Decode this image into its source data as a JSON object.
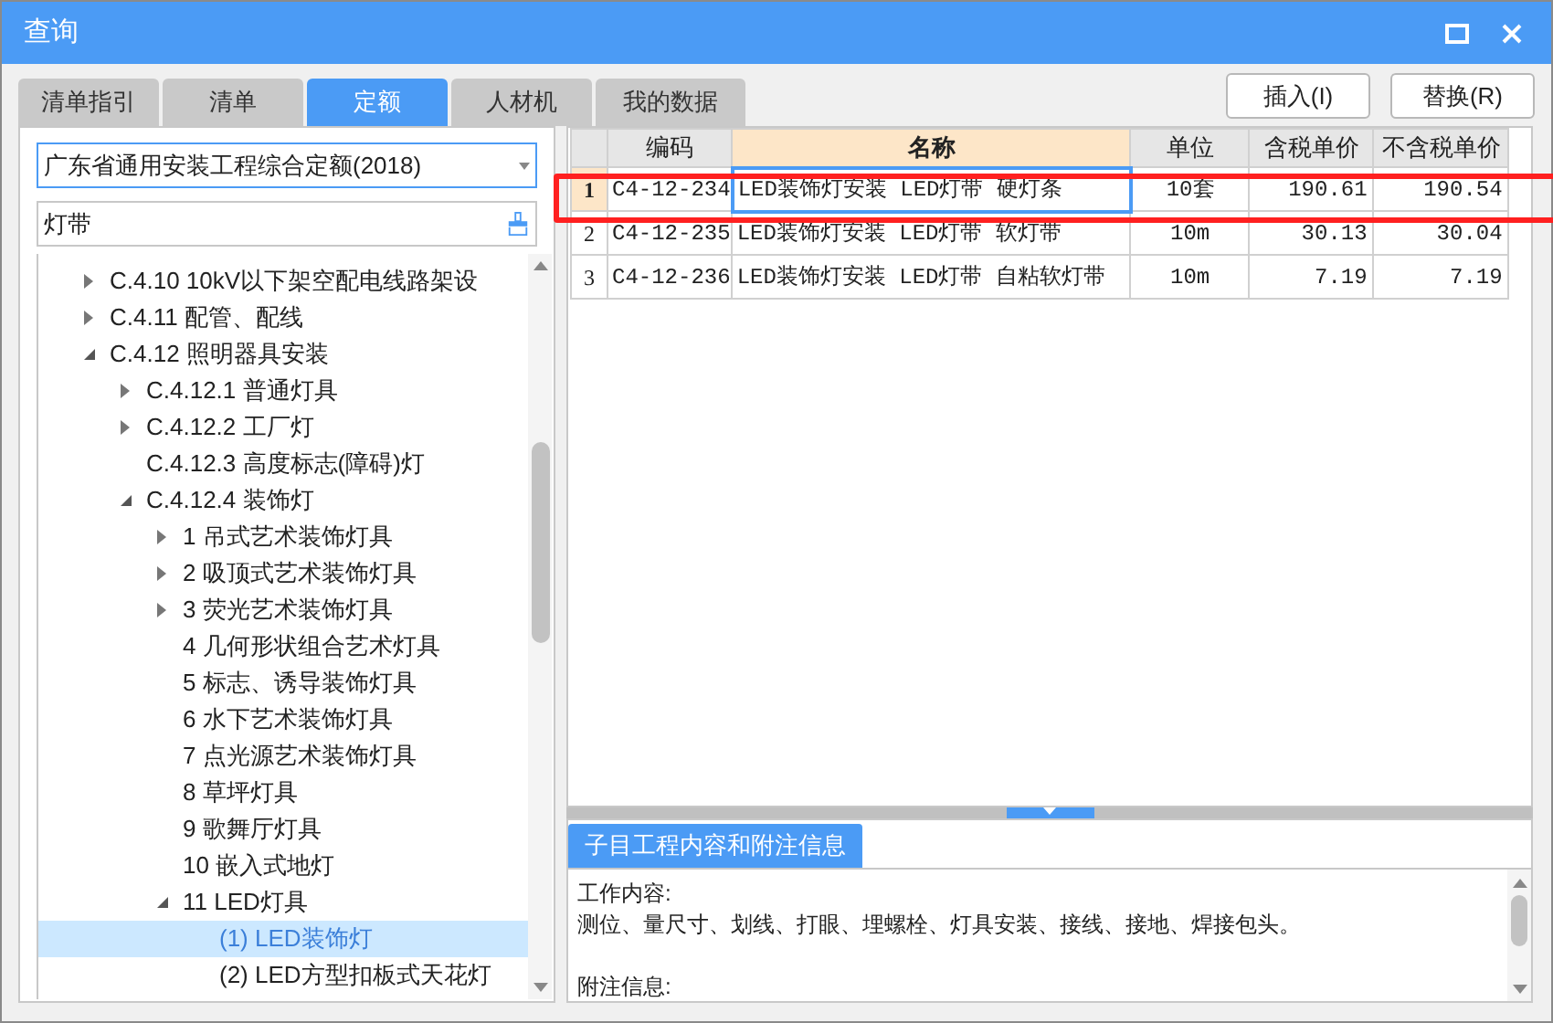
{
  "window": {
    "title": "查询"
  },
  "tabs": [
    {
      "label": "清单指引",
      "selected": false
    },
    {
      "label": "清单",
      "selected": false
    },
    {
      "label": "定额",
      "selected": true
    },
    {
      "label": "人材机",
      "selected": false
    },
    {
      "label": "我的数据",
      "selected": false
    }
  ],
  "buttons": [
    "插入(I)",
    "替换(R)"
  ],
  "library_select": {
    "value": "广东省通用安装工程综合定额(2018)"
  },
  "search": {
    "value": "灯带"
  },
  "tree": [
    {
      "label": "C.4.10 10kV以下架空配电线路架设",
      "expanded": false,
      "selected": false
    },
    {
      "label": "C.4.11 配管、配线",
      "expanded": false,
      "selected": false
    },
    {
      "label": "C.4.12 照明器具安装",
      "expanded": true,
      "selected": false,
      "children": [
        {
          "label": "C.4.12.1 普通灯具",
          "expanded": false,
          "selected": false
        },
        {
          "label": "C.4.12.2 工厂灯",
          "expanded": false,
          "selected": false
        },
        {
          "label": "C.4.12.3 高度标志(障碍)灯",
          "selected": false
        },
        {
          "label": "C.4.12.4 装饰灯",
          "expanded": true,
          "selected": false,
          "children": [
            {
              "label": "1 吊式艺术装饰灯具",
              "expanded": false,
              "selected": false
            },
            {
              "label": "2 吸顶式艺术装饰灯具",
              "expanded": false,
              "selected": false
            },
            {
              "label": "3 荧光艺术装饰灯具",
              "expanded": false,
              "selected": false
            },
            {
              "label": "4 几何形状组合艺术灯具",
              "selected": false
            },
            {
              "label": "5 标志、诱导装饰灯具",
              "selected": false
            },
            {
              "label": "6 水下艺术装饰灯具",
              "selected": false
            },
            {
              "label": "7 点光源艺术装饰灯具",
              "selected": false
            },
            {
              "label": "8 草坪灯具",
              "selected": false
            },
            {
              "label": "9 歌舞厅灯具",
              "selected": false
            },
            {
              "label": "10 嵌入式地灯",
              "selected": false
            },
            {
              "label": "11 LED灯具",
              "expanded": true,
              "selected": false,
              "children": [
                {
                  "label": "(1) LED装饰灯",
                  "selected": true
                },
                {
                  "label": "(2) LED方型扣板式天花灯",
                  "selected": false
                }
              ]
            }
          ]
        }
      ]
    }
  ],
  "table": {
    "columns": [
      {
        "label": "编码",
        "selected": false
      },
      {
        "label": "名称",
        "selected": true
      },
      {
        "label": "单位",
        "selected": false
      },
      {
        "label": "含税单价",
        "selected": false
      },
      {
        "label": "不含税单价",
        "selected": false
      }
    ],
    "rows": [
      {
        "number": "1",
        "selected": true,
        "marked": true,
        "cells": [
          "C4-12-234",
          "LED装饰灯安装 LED灯带 硬灯条",
          "10套",
          "190.61",
          "190.54"
        ]
      },
      {
        "number": "2",
        "selected": false,
        "marked": false,
        "cells": [
          "C4-12-235",
          "LED装饰灯安装 LED灯带 软灯带",
          "10m",
          "30.13",
          "30.04"
        ]
      },
      {
        "number": "3",
        "selected": false,
        "marked": false,
        "cells": [
          "C4-12-236",
          "LED装饰灯安装 LED灯带 自粘软灯带",
          "10m",
          "7.19",
          "7.19"
        ]
      }
    ]
  },
  "info_panel": {
    "tab": "子目工程内容和附注信息",
    "sections": [
      {
        "lines": [
          "工作内容:",
          "测位、量尺寸、划线、打眼、埋螺栓、灯具安装、接线、接地、焊接包头。"
        ]
      },
      {
        "lines": [
          "附注信息:"
        ]
      }
    ]
  }
}
